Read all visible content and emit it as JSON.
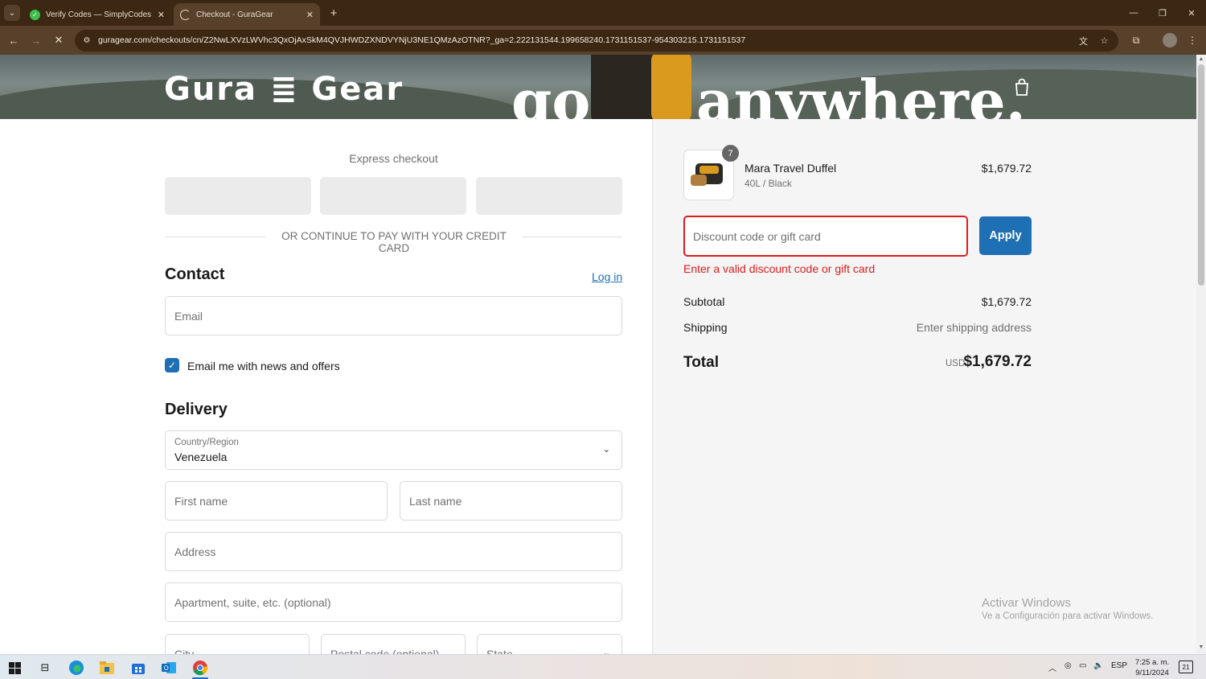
{
  "browser": {
    "tabs": [
      {
        "title": "Verify Codes — SimplyCodes",
        "icon": "simplycodes-check-icon",
        "active": false
      },
      {
        "title": "Checkout - GuraGear",
        "icon": "loading-spinner-icon",
        "active": true
      }
    ],
    "url": "guragear.com/checkouts/cn/Z2NwLXVzLWVhc3QxOjAxSkM4QVJHWDZXNDVYNjU3NE1QMzAzOTNR?_ga=2.222131544.199658240.1731151537-954303215.1731151537",
    "window_controls": [
      "minimize",
      "restore",
      "close"
    ]
  },
  "hero": {
    "brand": "Gura ≣ Gear",
    "tagline_left": "go",
    "tagline_right": "anywhere."
  },
  "checkout": {
    "express_title": "Express checkout",
    "divider_text": "OR CONTINUE TO PAY WITH YOUR CREDIT CARD",
    "contact": {
      "heading": "Contact",
      "login_link": "Log in",
      "email_placeholder": "Email",
      "newsletter_label": "Email me with news and offers",
      "newsletter_checked": true
    },
    "delivery": {
      "heading": "Delivery",
      "country_label": "Country/Region",
      "country_value": "Venezuela",
      "first_name_placeholder": "First name",
      "last_name_placeholder": "Last name",
      "address_placeholder": "Address",
      "apartment_placeholder": "Apartment, suite, etc. (optional)",
      "city_placeholder": "City",
      "postal_placeholder": "Postal code (optional)",
      "state_placeholder": "State"
    }
  },
  "summary": {
    "item": {
      "quantity": "7",
      "name": "Mara Travel Duffel",
      "variant": "40L / Black",
      "price": "$1,679.72"
    },
    "discount_placeholder": "Discount code or gift card",
    "apply_label": "Apply",
    "discount_error": "Enter a valid discount code or gift card",
    "subtotal_label": "Subtotal",
    "subtotal_value": "$1,679.72",
    "shipping_label": "Shipping",
    "shipping_value": "Enter shipping address",
    "total_label": "Total",
    "total_currency": "USD",
    "total_value": "$1,679.72"
  },
  "watermark": {
    "title": "Activar Windows",
    "subtitle": "Ve a Configuración para activar Windows."
  },
  "taskbar": {
    "language": "ESP",
    "time": "7:25 a. m.",
    "date": "9/11/2024",
    "notification_count": "21"
  },
  "colors": {
    "accent": "#1f6fb5",
    "error": "#dd1d1d",
    "browser_frame": "#3b2712"
  }
}
